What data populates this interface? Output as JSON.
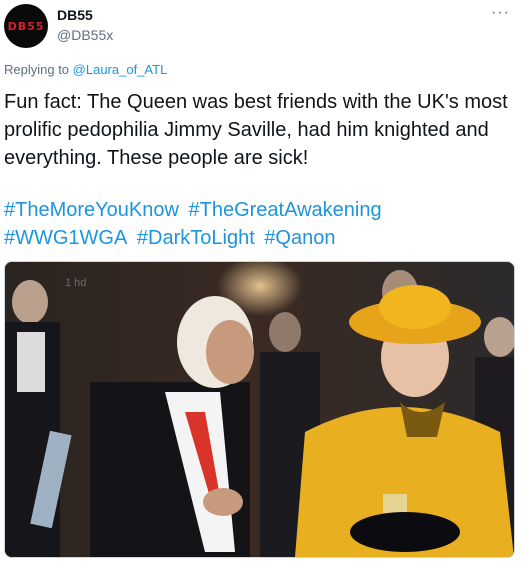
{
  "author": {
    "display_name": "DB55",
    "handle": "@DB55x",
    "avatar_text": "DB55"
  },
  "reply": {
    "prefix": "Replying to",
    "target": "@Laura_of_ATL"
  },
  "tweet": {
    "text": "Fun fact: The Queen was best friends with the UK's most prolific pedophilia Jimmy Saville, had him knighted and everything. These people are sick!",
    "hashtags": [
      "#TheMoreYouKnow",
      "#TheGreatAwakening",
      "#WWG1WGA",
      "#DarkToLight",
      "#Qanon"
    ]
  },
  "media": {
    "watermark": "1 hd"
  },
  "icons": {
    "more": "more-horizontal-icon"
  },
  "colors": {
    "link": "#1b95e0",
    "secondary_text": "#5b7083",
    "primary_text": "#0f1419",
    "queen_outfit": "#e8b020"
  }
}
